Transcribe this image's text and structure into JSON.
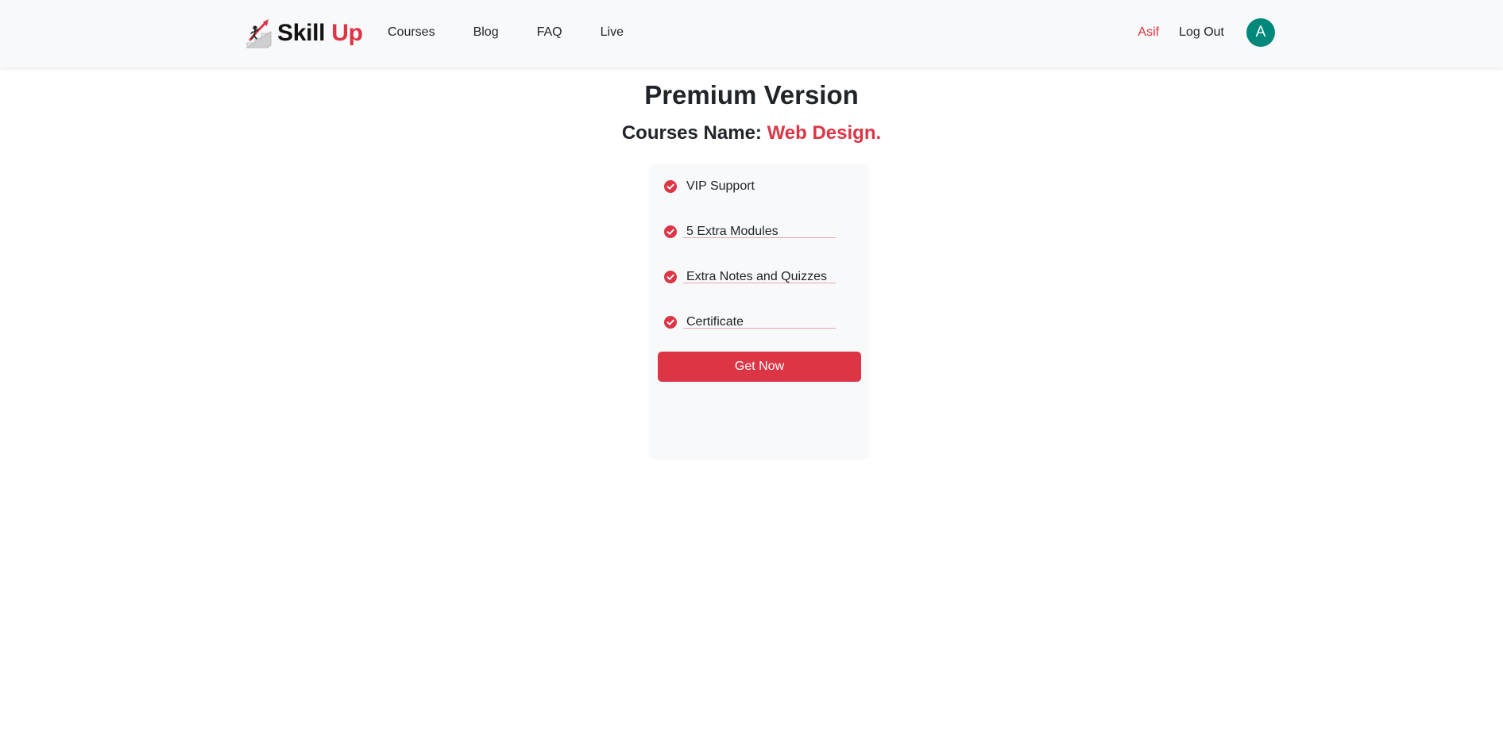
{
  "navbar": {
    "brand": {
      "logo_icon": "stairs-climber-icon",
      "name_part1": "Skill",
      "name_part2": "Up"
    },
    "links": [
      {
        "label": "Courses"
      },
      {
        "label": "Blog"
      },
      {
        "label": "FAQ"
      },
      {
        "label": "Live"
      }
    ],
    "user": {
      "name": "Asif",
      "logout_label": "Log Out",
      "avatar_initial": "A"
    }
  },
  "main": {
    "title": "Premium Version",
    "course_prefix": "Courses Name:",
    "course_name": "Web Design.",
    "features": [
      {
        "label": "VIP Support",
        "icon": "check-circle-icon"
      },
      {
        "label": "5 Extra Modules",
        "icon": "check-circle-icon"
      },
      {
        "label": "Extra Notes and Quizzes",
        "icon": "check-circle-icon"
      },
      {
        "label": "Certificate",
        "icon": "check-circle-icon"
      }
    ],
    "cta_label": "Get Now"
  },
  "colors": {
    "accent": "#dc3545",
    "navbar_bg": "#f8f9fa",
    "avatar_bg": "#00897b",
    "divider": "#e9a7b0"
  }
}
